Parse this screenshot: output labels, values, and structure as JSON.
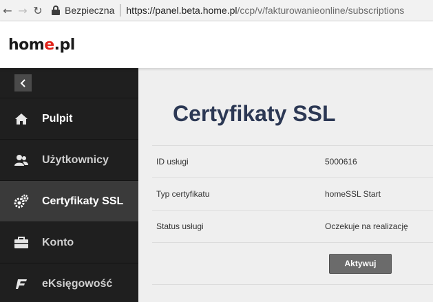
{
  "browser": {
    "secure_label": "Bezpieczna",
    "url_host": "https://panel.beta.home.pl",
    "url_path": "/ccp/v/fakturowanieonline/subscriptions"
  },
  "header": {
    "logo_prefix": "hom",
    "logo_accent": "e",
    "logo_suffix": ".pl",
    "accent_color": "#e2231a"
  },
  "sidebar": {
    "items": [
      {
        "label": "Pulpit",
        "icon": "home-icon"
      },
      {
        "label": "Użytkownicy",
        "icon": "users-icon"
      },
      {
        "label": "Certyfikaty SSL",
        "icon": "gears-icon",
        "active": true
      },
      {
        "label": "Konto",
        "icon": "briefcase-icon"
      },
      {
        "label": "eKsięgowość",
        "icon": "ebook-f-icon"
      }
    ]
  },
  "main": {
    "title": "Certyfikaty SSL",
    "rows": [
      {
        "key": "ID usługi",
        "value": "5000616"
      },
      {
        "key": "Typ certyfikatu",
        "value": "homeSSL Start"
      },
      {
        "key": "Status usługi",
        "value": "Oczekuje na realizację"
      }
    ],
    "activate_label": "Aktywuj"
  }
}
